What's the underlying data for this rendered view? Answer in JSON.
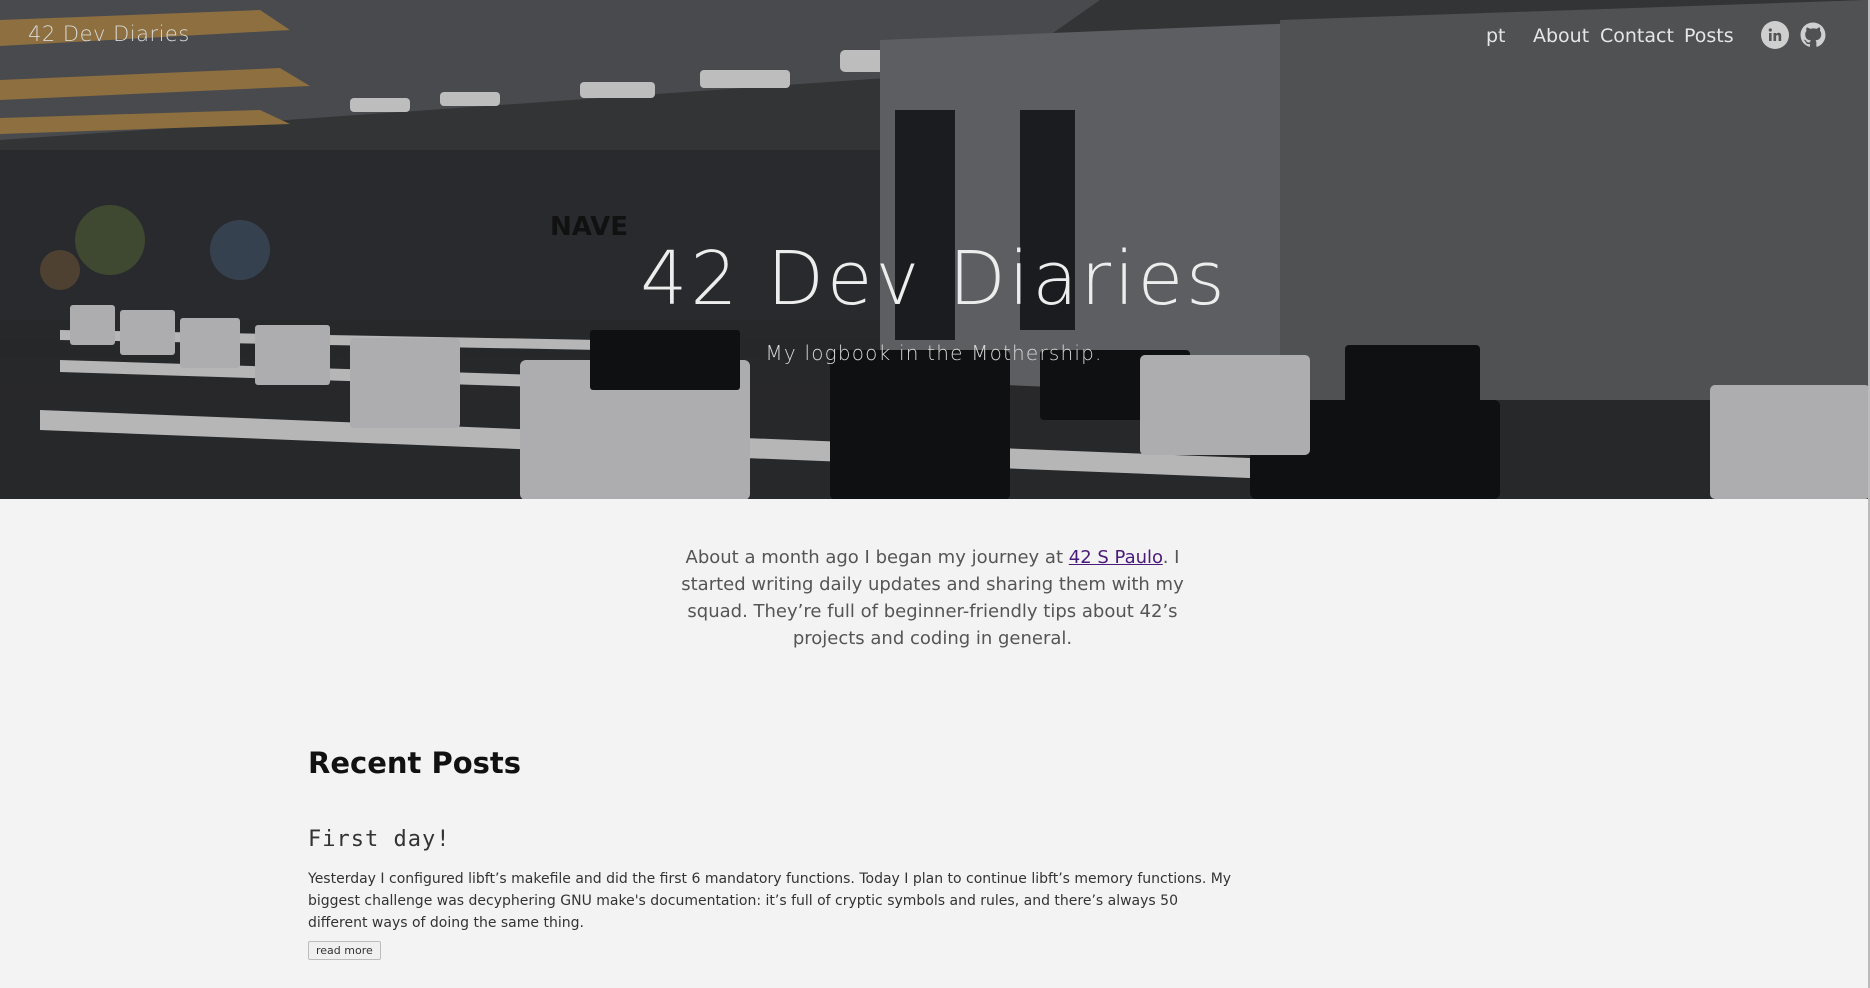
{
  "header": {
    "brand": "42 Dev Diaries",
    "nav": {
      "lang": "pt",
      "about": "About",
      "contact": "Contact",
      "posts": "Posts"
    },
    "social": [
      {
        "icon": "linkedin-icon"
      },
      {
        "icon": "github-icon"
      }
    ]
  },
  "hero": {
    "title": "42 Dev Diaries",
    "subtitle": "My logbook in the Mothership."
  },
  "intro": {
    "text_before": "About a month ago I began my journey at ",
    "link_text": "42 S Paulo",
    "text_after": ". I started writing daily updates and sharing them with my squad. They’re full of beginner-friendly tips about 42’s projects and coding in general."
  },
  "recent_posts": {
    "heading": "Recent Posts",
    "items": [
      {
        "title": "First day!",
        "excerpt": "Yesterday I configured libft’s makefile and did the first 6 mandatory functions. Today I plan to continue libft’s memory functions. My biggest challenge was decyphering GNU make's documentation: it’s full of cryptic symbols and rules, and there’s always 50 different ways of doing the same thing.",
        "read_more": "read more"
      }
    ]
  },
  "colors": {
    "page_bg": "#f3f3f3",
    "link": "#4a1a7a",
    "hero_text": "#ededed"
  }
}
